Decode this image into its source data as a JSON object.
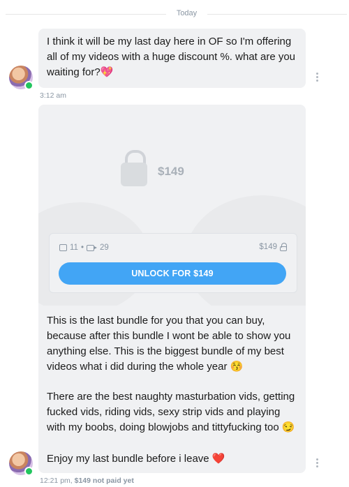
{
  "divider": {
    "label": "Today"
  },
  "messages": [
    {
      "text": "I think it will be my last day here in OF so I'm offering all of my videos with a huge discount %. what are you waiting for?💖",
      "time": "3:12 am"
    },
    {
      "media": {
        "price_overlay": "$149",
        "image_count": "11",
        "separator": "•",
        "video_count": "29",
        "price": "$149",
        "unlock_label": "UNLOCK FOR $149"
      },
      "paragraphs": [
        "This is the last bundle for you that you can buy, because after this bundle I wont be able to show you anything else. This is the biggest bundle of my best videos what i did during the whole year 😚",
        "There are the best naughty masturbation vids, getting fucked vids, riding vids, sexy strip vids and playing with my boobs, doing blowjobs and tittyfucking too 😏",
        "Enjoy my last bundle before i leave ❤️"
      ],
      "time": "12:21 pm,",
      "status": "$149 not paid yet"
    }
  ],
  "colors": {
    "accent": "#42a5f5",
    "bubble": "#f0f1f3",
    "online": "#22c55e",
    "muted": "#8a96a3"
  },
  "icons": {
    "lock": "lock-icon",
    "image": "image-icon",
    "video": "video-icon",
    "more": "more-vertical-icon"
  }
}
